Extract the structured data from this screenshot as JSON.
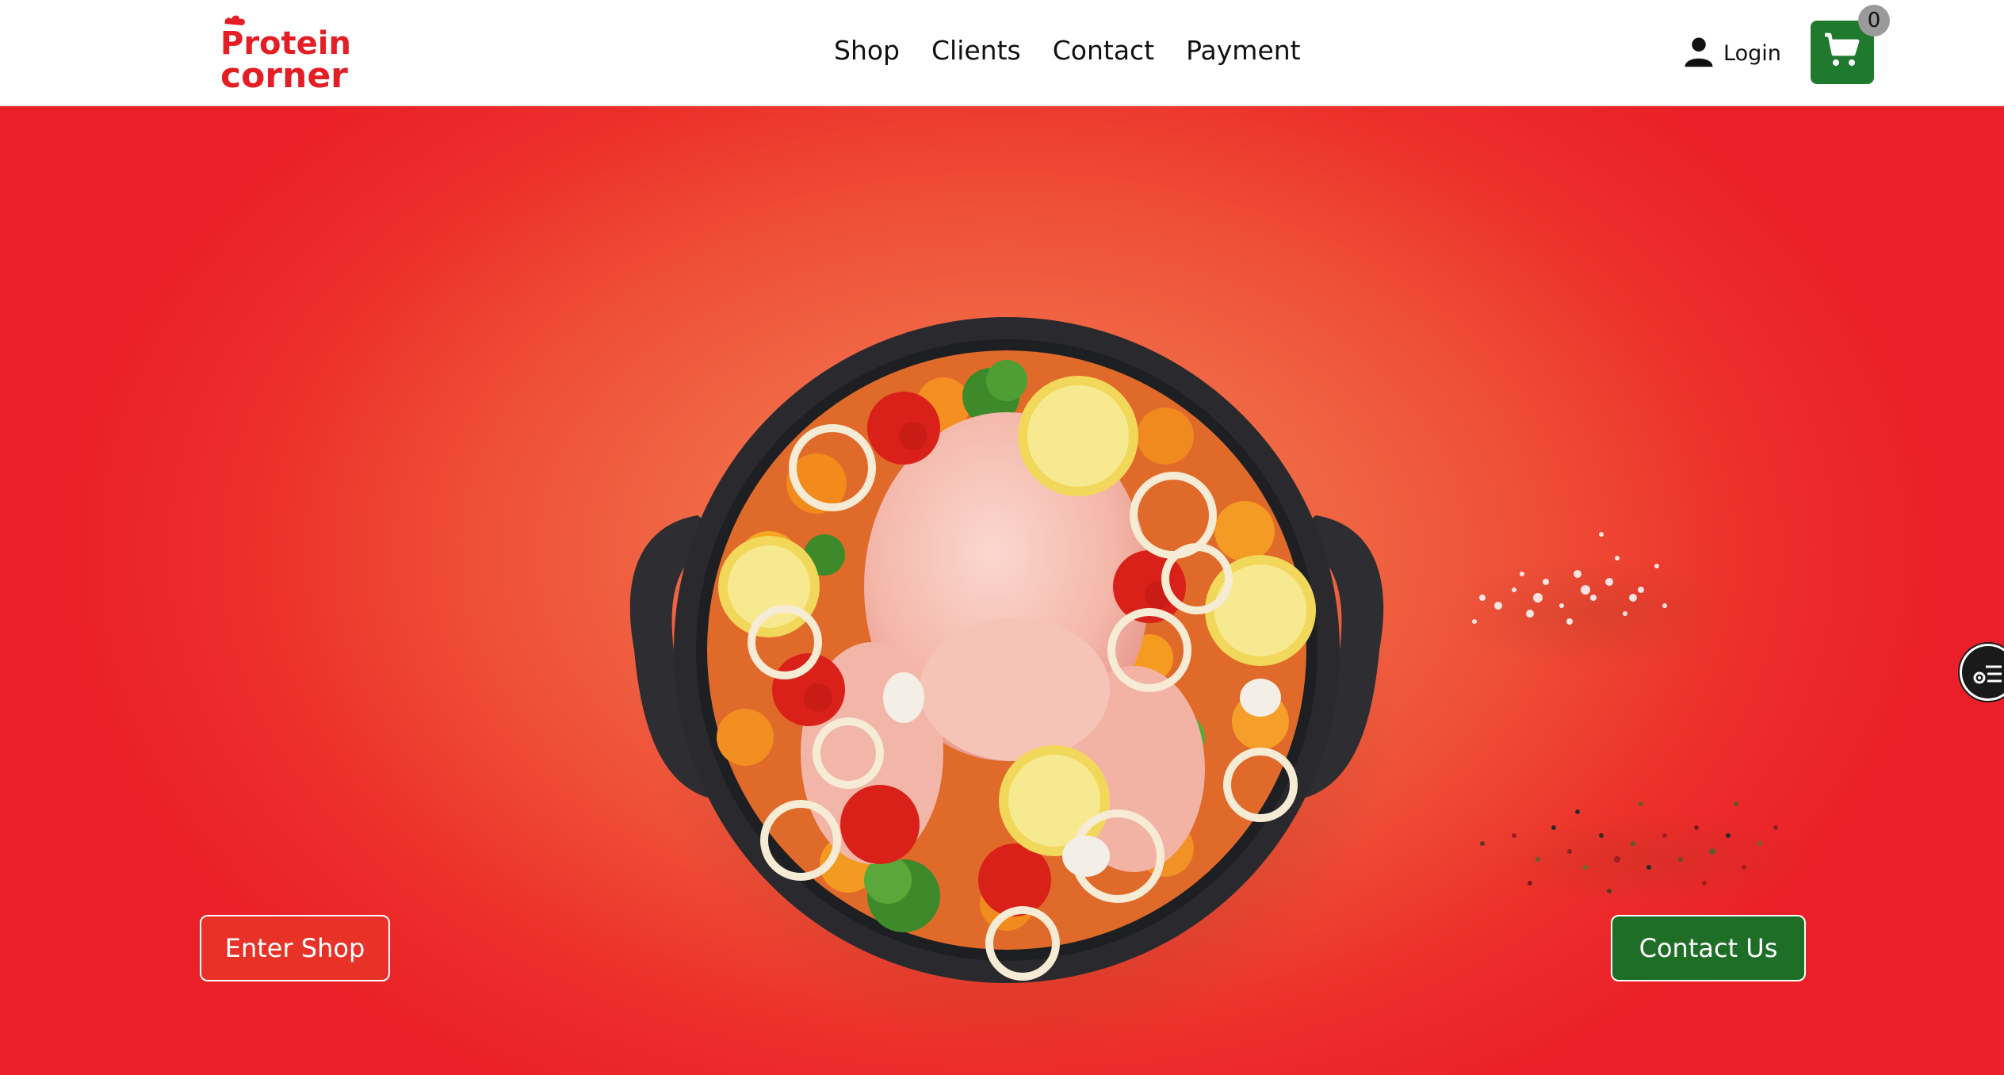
{
  "brand": {
    "logo_line1": "Protein",
    "logo_line2": "corner",
    "primary_color": "#e31e24",
    "cart_color": "#1f7a2e"
  },
  "nav": {
    "items": [
      "Shop",
      "Clients",
      "Contact",
      "Payment"
    ]
  },
  "header": {
    "login_label": "Login",
    "login_icon": "user-icon",
    "cart_icon": "cart-icon",
    "cart_count": "0"
  },
  "hero": {
    "enter_shop_label": "Enter Shop",
    "contact_us_label": "Contact Us",
    "image": "roast-chicken-vegetables-in-cast-iron-pan",
    "decor": "salt-and-pepper-sprinkles",
    "side_widget_icon": "accessibility-menu-icon"
  }
}
